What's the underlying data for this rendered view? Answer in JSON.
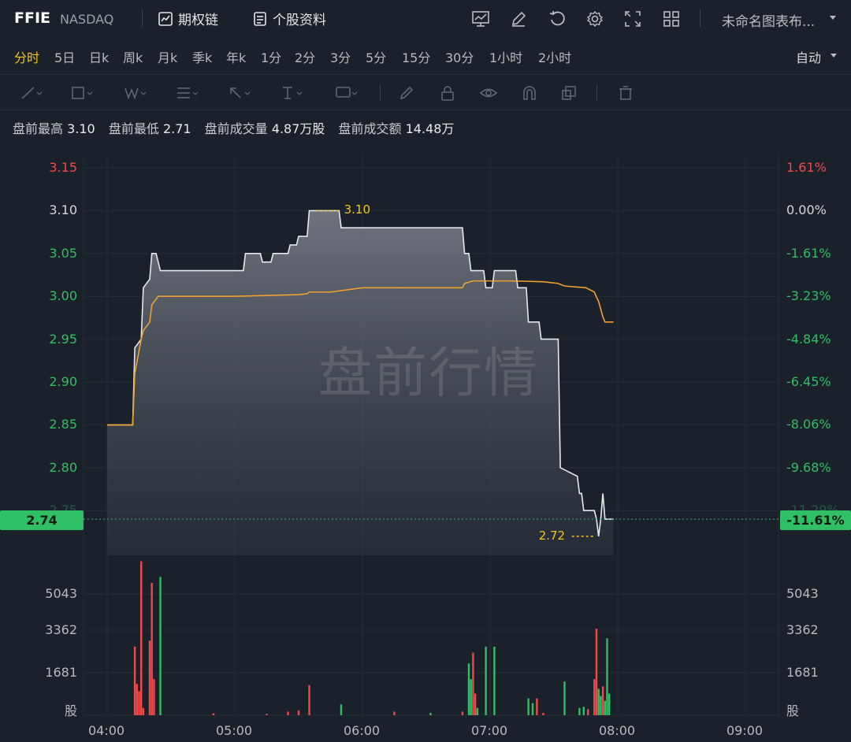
{
  "header": {
    "symbol": "FFIE",
    "exchange": "NASDAQ",
    "options_chain": "期权链",
    "stock_info": "个股资料",
    "chart_name": "未命名图表布..."
  },
  "toolbar_icons": [
    "chart-icon",
    "pen-icon",
    "refresh-icon",
    "gear-icon",
    "fullscreen-icon",
    "layout-grid-icon"
  ],
  "periods": [
    "分时",
    "5日",
    "日k",
    "周k",
    "月k",
    "季k",
    "年k",
    "1分",
    "2分",
    "3分",
    "5分",
    "15分",
    "30分",
    "1小时",
    "2小时"
  ],
  "active_period": "分时",
  "scale_mode": "自动",
  "drawing_tools": [
    "line-tool-icon",
    "rect-tool-icon",
    "wave-tool-icon",
    "fib-tool-icon",
    "arrow-tool-icon",
    "text-tool-icon",
    "annotation-tool-icon",
    "brush-tool-icon",
    "lock-icon",
    "eye-icon",
    "magnet-icon",
    "copy-icon",
    "trash-icon"
  ],
  "stats": {
    "high_label": "盘前最高",
    "high_value": "3.10",
    "low_label": "盘前最低",
    "low_value": "2.71",
    "volume_label": "盘前成交量",
    "volume_value": "4.87万股",
    "amount_label": "盘前成交额",
    "amount_value": "14.48万"
  },
  "watermark": "盘前行情",
  "colors": {
    "up": "#ef4a4a",
    "down": "#2fbf64",
    "avg_line": "#f0a030",
    "price_line": "#e8e8e8",
    "highlight": "#f5c518"
  },
  "chart_data": {
    "type": "line",
    "price_axis": [
      "3.15",
      "3.10",
      "3.05",
      "3.00",
      "2.95",
      "2.90",
      "2.85",
      "2.80",
      "2.75"
    ],
    "pct_axis": [
      "1.61%",
      "0.00%",
      "-1.61%",
      "-3.23%",
      "-4.84%",
      "-6.45%",
      "-8.06%",
      "-9.68%",
      "-11.29%"
    ],
    "last_price": "2.74",
    "last_pct": "-11.61%",
    "high_marker": "3.10",
    "low_marker": "2.72",
    "ylim": [
      2.7,
      3.17
    ],
    "xlim": [
      "04:00",
      "09:30"
    ],
    "x_ticks": [
      "04:00",
      "05:00",
      "06:00",
      "07:00",
      "08:00",
      "09:00"
    ],
    "price_series": {
      "x": [
        "04:00",
        "04:12",
        "04:13",
        "04:16",
        "04:17",
        "04:20",
        "04:21",
        "04:23",
        "04:25",
        "04:26",
        "05:04",
        "05:05",
        "05:12",
        "05:13",
        "05:17",
        "05:18",
        "05:25",
        "05:26",
        "05:29",
        "05:30",
        "05:34",
        "05:35",
        "05:37",
        "05:38",
        "05:49",
        "05:50",
        "06:47",
        "06:48",
        "06:50",
        "06:51",
        "06:57",
        "06:58",
        "07:01",
        "07:02",
        "07:12",
        "07:13",
        "07:17",
        "07:18",
        "07:23",
        "07:24",
        "07:32",
        "07:33",
        "07:41",
        "07:42",
        "07:43",
        "07:44",
        "07:49",
        "07:50",
        "07:51",
        "07:52",
        "07:53",
        "07:54",
        "07:55",
        "07:56",
        "07:57",
        "07:58"
      ],
      "y": [
        2.85,
        2.85,
        2.94,
        2.95,
        3.01,
        3.02,
        3.05,
        3.05,
        3.03,
        3.03,
        3.03,
        3.05,
        3.05,
        3.04,
        3.04,
        3.05,
        3.05,
        3.06,
        3.06,
        3.07,
        3.07,
        3.1,
        3.1,
        3.1,
        3.1,
        3.08,
        3.08,
        3.05,
        3.05,
        3.03,
        3.03,
        3.01,
        3.01,
        3.03,
        3.03,
        3.01,
        3.01,
        2.97,
        2.97,
        2.95,
        2.95,
        2.8,
        2.79,
        2.77,
        2.77,
        2.75,
        2.75,
        2.74,
        2.72,
        2.74,
        2.77,
        2.74,
        2.74,
        2.74,
        2.74,
        2.74
      ]
    },
    "avg_series": {
      "x": [
        "04:00",
        "04:12",
        "04:13",
        "04:16",
        "04:17",
        "04:20",
        "04:21",
        "04:24",
        "04:30",
        "05:00",
        "05:30",
        "05:34",
        "05:35",
        "05:45",
        "06:00",
        "06:30",
        "06:47",
        "06:48",
        "06:52",
        "07:00",
        "07:10",
        "07:25",
        "07:32",
        "07:35",
        "07:45",
        "07:49",
        "07:50",
        "07:51",
        "07:52",
        "07:53",
        "07:54",
        "07:55",
        "07:56",
        "07:57",
        "07:58"
      ],
      "y": [
        2.85,
        2.85,
        2.91,
        2.95,
        2.96,
        2.97,
        2.99,
        3.0,
        3.0,
        3.0,
        3.002,
        3.003,
        3.005,
        3.005,
        3.01,
        3.01,
        3.01,
        3.015,
        3.018,
        3.018,
        3.018,
        3.017,
        3.015,
        3.012,
        3.01,
        3.005,
        2.999,
        2.994,
        2.985,
        2.976,
        2.97,
        2.97,
        2.97,
        2.97,
        2.97
      ]
    },
    "volume_axis": [
      "5043",
      "3362",
      "1681",
      "股"
    ],
    "volume_ylim": [
      0,
      6300
    ],
    "volume_bars": [
      {
        "t": "04:13",
        "v": 2850,
        "c": "up"
      },
      {
        "t": "04:14",
        "v": 1300,
        "c": "up"
      },
      {
        "t": "04:15",
        "v": 1000,
        "c": "up"
      },
      {
        "t": "04:16",
        "v": 6400,
        "c": "up"
      },
      {
        "t": "04:17",
        "v": 300,
        "c": "up"
      },
      {
        "t": "04:20",
        "v": 3100,
        "c": "up"
      },
      {
        "t": "04:21",
        "v": 5500,
        "c": "up"
      },
      {
        "t": "04:22",
        "v": 1500,
        "c": "up"
      },
      {
        "t": "04:25",
        "v": 5750,
        "c": "down"
      },
      {
        "t": "04:50",
        "v": 80,
        "c": "up"
      },
      {
        "t": "05:15",
        "v": 60,
        "c": "up"
      },
      {
        "t": "05:25",
        "v": 150,
        "c": "up"
      },
      {
        "t": "05:30",
        "v": 200,
        "c": "up"
      },
      {
        "t": "05:35",
        "v": 1250,
        "c": "up"
      },
      {
        "t": "05:50",
        "v": 450,
        "c": "down"
      },
      {
        "t": "06:15",
        "v": 150,
        "c": "up"
      },
      {
        "t": "06:32",
        "v": 100,
        "c": "down"
      },
      {
        "t": "06:47",
        "v": 150,
        "c": "up"
      },
      {
        "t": "06:50",
        "v": 2150,
        "c": "down"
      },
      {
        "t": "06:51",
        "v": 1500,
        "c": "down"
      },
      {
        "t": "06:52",
        "v": 2600,
        "c": "up"
      },
      {
        "t": "06:53",
        "v": 900,
        "c": "up"
      },
      {
        "t": "06:54",
        "v": 300,
        "c": "down"
      },
      {
        "t": "06:58",
        "v": 2850,
        "c": "down"
      },
      {
        "t": "07:02",
        "v": 2850,
        "c": "down"
      },
      {
        "t": "07:18",
        "v": 700,
        "c": "down"
      },
      {
        "t": "07:20",
        "v": 500,
        "c": "down"
      },
      {
        "t": "07:22",
        "v": 700,
        "c": "up"
      },
      {
        "t": "07:25",
        "v": 100,
        "c": "up"
      },
      {
        "t": "07:35",
        "v": 1400,
        "c": "down"
      },
      {
        "t": "07:42",
        "v": 300,
        "c": "down"
      },
      {
        "t": "07:44",
        "v": 350,
        "c": "down"
      },
      {
        "t": "07:46",
        "v": 250,
        "c": "up"
      },
      {
        "t": "07:49",
        "v": 1500,
        "c": "up"
      },
      {
        "t": "07:50",
        "v": 3600,
        "c": "up"
      },
      {
        "t": "07:51",
        "v": 1100,
        "c": "down"
      },
      {
        "t": "07:52",
        "v": 800,
        "c": "down"
      },
      {
        "t": "07:53",
        "v": 1200,
        "c": "up"
      },
      {
        "t": "07:54",
        "v": 600,
        "c": "down"
      },
      {
        "t": "07:55",
        "v": 3200,
        "c": "down"
      },
      {
        "t": "07:56",
        "v": 900,
        "c": "down"
      }
    ]
  }
}
